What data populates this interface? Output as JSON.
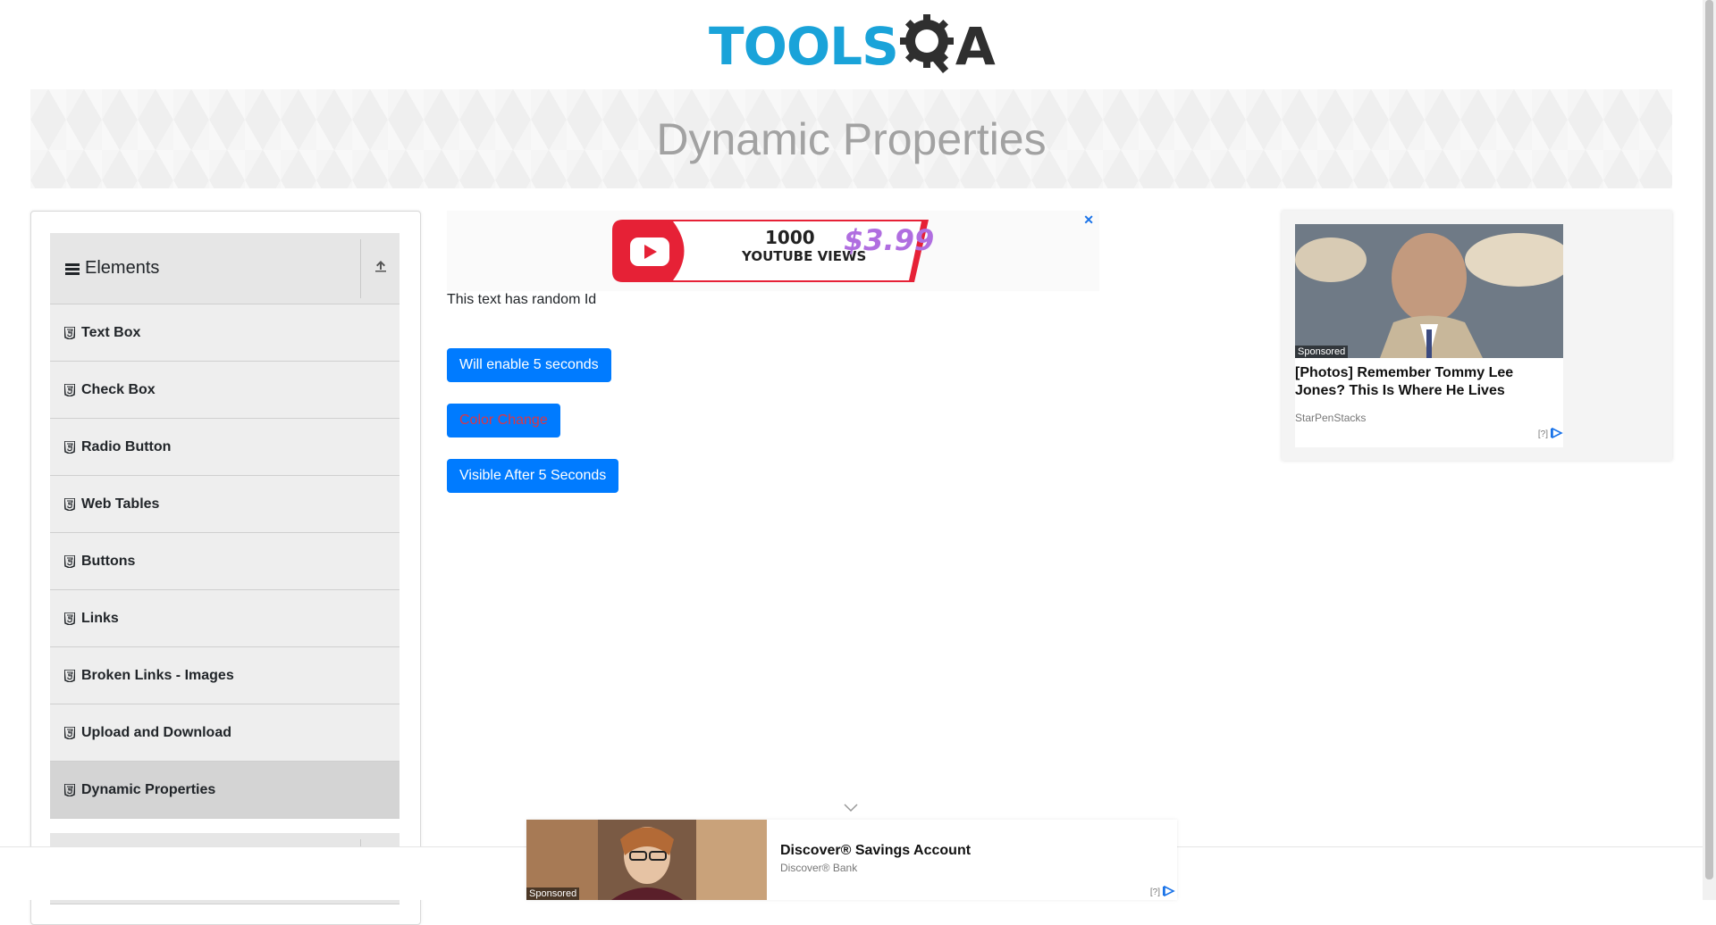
{
  "header": {
    "logo_text": "TOOLS",
    "logo_suffix": "A"
  },
  "banner": {
    "title": "Dynamic Properties"
  },
  "sidebar": {
    "group_title": "Elements",
    "items": [
      {
        "label": "Text Box"
      },
      {
        "label": "Check Box"
      },
      {
        "label": "Radio Button"
      },
      {
        "label": "Web Tables"
      },
      {
        "label": "Buttons"
      },
      {
        "label": "Links"
      },
      {
        "label": "Broken Links - Images"
      },
      {
        "label": "Upload and Download"
      },
      {
        "label": "Dynamic Properties"
      }
    ],
    "active_item": "Dynamic Properties"
  },
  "main": {
    "random_text": "This text has random Id",
    "enable_button_label": "Will enable 5 seconds",
    "color_button_label": "Color Change",
    "visible_button_label": "Visible After 5 Seconds"
  },
  "ads": {
    "top_banner": {
      "views": "1000",
      "views_label": "YOUTUBE VIEWS",
      "price": "$3.99",
      "close": "✕"
    },
    "right": {
      "sponsored": "Sponsored",
      "headline": "[Photos] Remember Tommy Lee Jones? This Is Where He Lives",
      "source": "StarPenStacks",
      "choice": "[?]"
    },
    "bottom": {
      "sponsored": "Sponsored",
      "title": "Discover® Savings Account",
      "source": "Discover® Bank",
      "choice": "[?]"
    }
  },
  "colors": {
    "logo_blue": "#1aa3d9",
    "primary_button": "#007bff",
    "color_change_text": "#dc3545",
    "banner_title": "#a2a2a2",
    "menu_bg": "#eeeeee",
    "menu_active_bg": "#d4d4d4"
  }
}
